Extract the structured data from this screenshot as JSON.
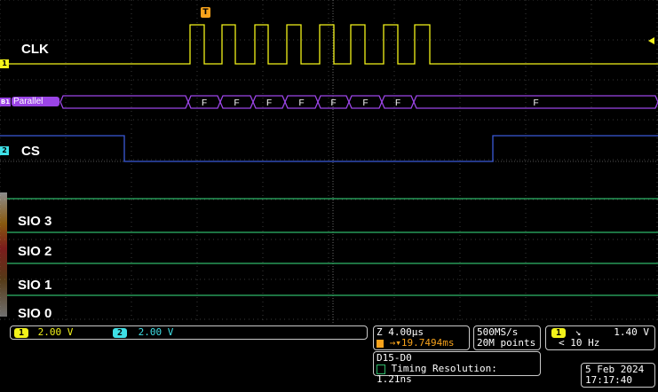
{
  "waveform": {
    "clk_label": "CLK",
    "cs_label": "CS",
    "parallel_label": "Parallel",
    "bus_value": "F",
    "sio_labels": [
      "SIO 3",
      "SIO 2",
      "SIO 1",
      "SIO 0"
    ],
    "trigger_marker": "T",
    "ch1_marker": "1",
    "ch2_marker": "2",
    "bus_marker": "B1"
  },
  "status": {
    "ch1_chip": "1",
    "ch1_scale": "2.00 V",
    "ch2_chip": "2",
    "ch2_scale": "2.00 V",
    "horizontal_scale": "Z 4.00µs",
    "trigger_pos": "19.7494ms",
    "sample_rate": "500MS/s",
    "record_length": "20M points",
    "trig_chip": "1",
    "trig_level": "1.40 V",
    "trig_freq": "< 10 Hz",
    "digital_channels": "D15-D0",
    "timing_resolution": "Timing Resolution: 1.21ns",
    "date": "5 Feb  2024",
    "time": "17:17:40"
  },
  "colors": {
    "ch1": "#f2f21a",
    "ch2": "#3fe0e6",
    "bus": "#9b45e6",
    "digital": "#2fb86a",
    "grid": "#3a3a3a"
  }
}
